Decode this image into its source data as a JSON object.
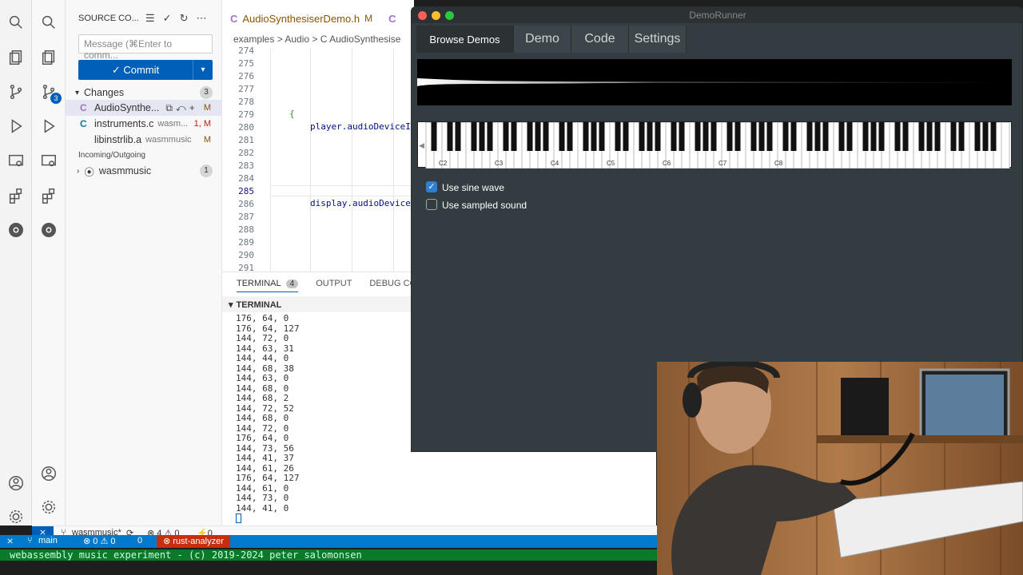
{
  "scm": {
    "title": "SOURCE CO...",
    "message_placeholder": "Message (⌘Enter to comm...",
    "commit_label": "✓ Commit",
    "changes_label": "Changes",
    "changes_count": "3",
    "files": [
      {
        "icon": "C",
        "name": "AudioSynthe...",
        "status": "M",
        "path": ""
      },
      {
        "icon": "C",
        "name": "instruments.c",
        "status": "1, M",
        "path": "wasm..."
      },
      {
        "icon": "",
        "name": "libinstrlib.a",
        "status": "M",
        "path": "wasmmusic"
      }
    ],
    "incoming_label": "Incoming/Outgoing",
    "incoming_item": "wasmmusic",
    "incoming_count": "1"
  },
  "activity": {
    "scm_badge": "3"
  },
  "editor": {
    "tab1": "AudioSynthesiserDemo.h",
    "tab1_status": "M",
    "breadcrumbs": "examples > Audio > C AudioSynthesise",
    "line_numbers": [
      "274",
      "275",
      "276",
      "277",
      "278",
      "279",
      "280",
      "281",
      "282",
      "283",
      "284",
      "285",
      "286",
      "287",
      "288",
      "289",
      "290",
      "291"
    ],
    "code_brace": "{",
    "code_line1": "player.audioDeviceIO",
    "code_line2": "display.audioDeviceI"
  },
  "panel": {
    "tab_terminal": "TERMINAL",
    "tab_terminal_badge": "4",
    "tab_output": "OUTPUT",
    "tab_debug": "DEBUG CONS",
    "terminal_header": "TERMINAL",
    "lines": [
      "176, 64, 0",
      "176, 64, 127",
      "144, 72, 0",
      "144, 63, 31",
      "144, 44, 0",
      "144, 68, 38",
      "144, 63, 0",
      "144, 68, 0",
      "144, 68, 2",
      "144, 72, 52",
      "144, 68, 0",
      "144, 72, 0",
      "176, 64, 0",
      "144, 73, 56",
      "144, 41, 37",
      "144, 61, 26",
      "176, 64, 127",
      "144, 61, 0",
      "144, 73, 0",
      "144, 41, 0"
    ]
  },
  "status": {
    "branch": "wasmmusic*",
    "errors": "⊗ 4 ⚠ 0",
    "ports": "⚡0"
  },
  "outer_status": {
    "branch": "main",
    "errors": "⊗ 0 ⚠ 0",
    "ports": "0",
    "rust": "⊗ rust-analyzer"
  },
  "bottom_terminal": "webassembly music experiment - (c) 2019-2024 peter salomonsen",
  "demo": {
    "window_title": "DemoRunner",
    "tabs": [
      "Browse Demos",
      "Demo",
      "Code",
      "Settings"
    ],
    "keys": [
      "C2",
      "C3",
      "C4",
      "C5",
      "C6",
      "C7",
      "C8"
    ],
    "opt_sine": "Use sine wave",
    "opt_sampled": "Use sampled sound",
    "sine_checked": true,
    "sampled_checked": false
  }
}
